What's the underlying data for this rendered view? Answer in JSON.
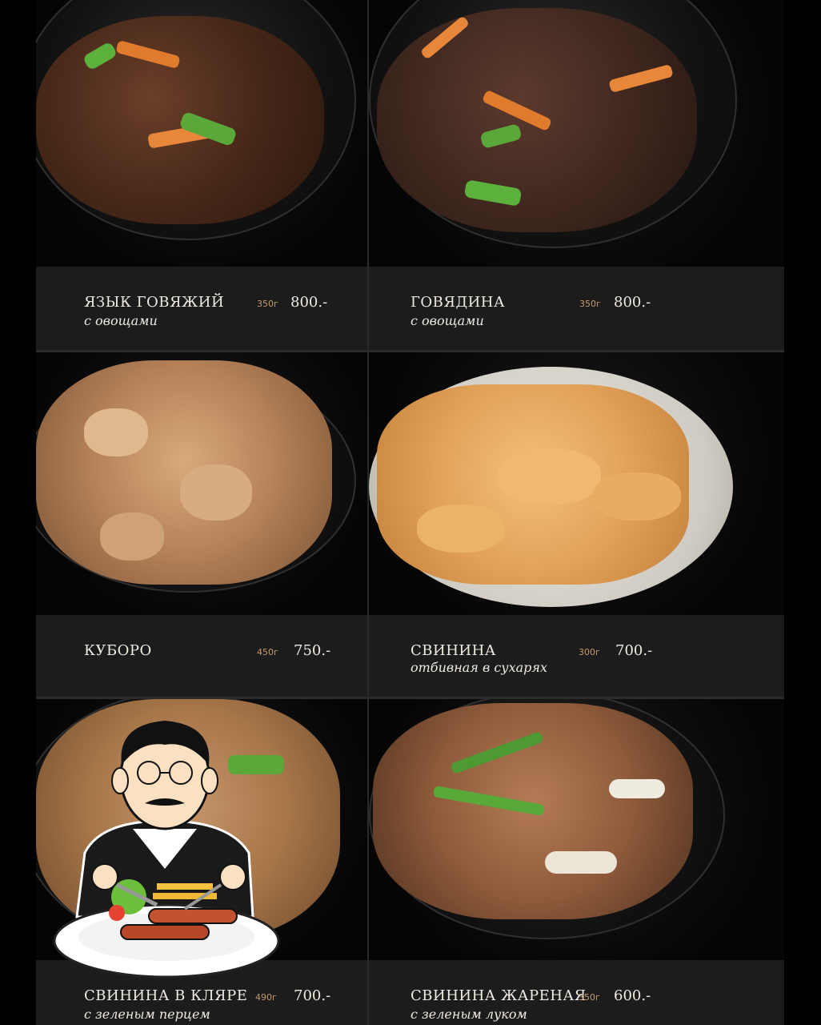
{
  "items": [
    {
      "name": "ЯЗЫК ГОВЯЖИЙ",
      "sub": "с овощами",
      "weight": "350г",
      "price": "800.-"
    },
    {
      "name": "ГОВЯДИНА",
      "sub": "с овощами",
      "weight": "350г",
      "price": "800.-"
    },
    {
      "name": "КУБОРО",
      "sub": "",
      "weight": "450г",
      "price": "750.-"
    },
    {
      "name": "СВИНИНА",
      "sub": "отбивная в сухарях",
      "weight": "300г",
      "price": "700.-"
    },
    {
      "name": "СВИНИНА В КЛЯРЕ",
      "sub": "с зеленым перцем",
      "weight": "490г",
      "price": "700.-"
    },
    {
      "name": "СВИНИНА ЖАРЕНАЯ",
      "sub": "с зеленым луком",
      "weight": "350г",
      "price": "600.-"
    }
  ],
  "icon": "restaurant-chef-icon"
}
